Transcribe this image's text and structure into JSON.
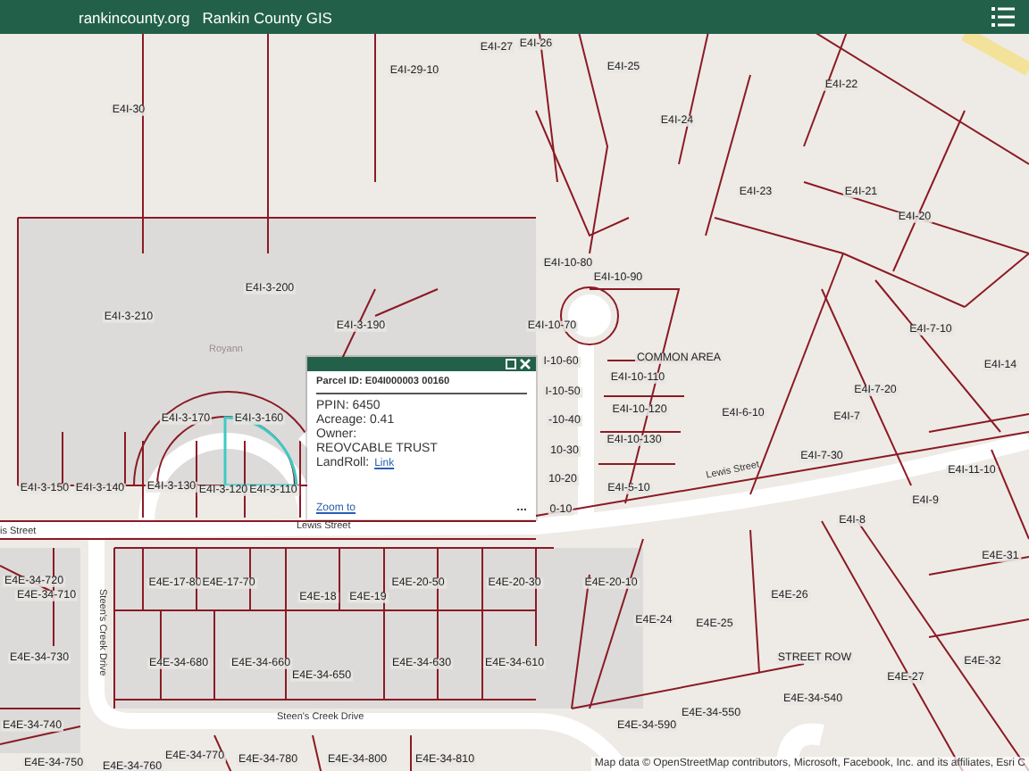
{
  "header": {
    "site_link": "rankincounty.org",
    "title": "Rankin County GIS"
  },
  "map": {
    "parcel_labels": [
      "E4I-27",
      "E4I-26",
      "E4I-29-10",
      "E4I-30",
      "E4I-25",
      "E4I-22",
      "E4I-24",
      "E4I-23",
      "E4I-21",
      "E4I-20",
      "E4I-3-200",
      "E4I-3-210",
      "E4I-3-190",
      "E4I-10-80",
      "E4I-10-90",
      "E4I-10-70",
      "I-10-60",
      "COMMON AREA",
      "I-10-50",
      "-10-40",
      "10-30",
      "10-20",
      "0-10",
      "E4I-10-110",
      "E4I-10-120",
      "E4I-10-130",
      "E4I-6-10",
      "E4I-5-10",
      "E4I-7-10",
      "E4I-14",
      "E4I-7-20",
      "E4I-7",
      "E4I-7-30",
      "E4I-11-10",
      "E4I-9",
      "E4I-8",
      "E4I-3-170",
      "E4I-3-160",
      "E4I-3-150",
      "E4I-3-140",
      "E4I-3-130",
      "E4I-3-120",
      "E4I-3-110",
      "E4E-34-720",
      "E4E-34-710",
      "E4E-17-80",
      "E4E-17-70",
      "E4E-18",
      "E4E-19",
      "E4E-20-50",
      "E4E-20-30",
      "E4E-20-10",
      "E4E-24",
      "E4E-25",
      "E4E-26",
      "STREET ROW",
      "E4E-27",
      "E4E-32",
      "E4E-31",
      "E4E-34-730",
      "E4E-34-680",
      "E4E-34-660",
      "E4E-34-650",
      "E4E-34-630",
      "E4E-34-610",
      "E4E-34-740",
      "E4E-34-590",
      "E4E-34-550",
      "E4E-34-540",
      "E4E-34-750",
      "E4E-34-760",
      "E4E-34-770",
      "E4E-34-780",
      "E4E-34-800",
      "E4E-34-810"
    ],
    "street_labels": [
      "Royann",
      "Lewis Street",
      "is Street",
      "Lewis Street",
      "Steen's Creek Drive",
      "Steen's Creek Drive"
    ],
    "attribution": "Map data © OpenStreetMap contributors, Microsoft, Facebook, Inc. and its affiliates, Esri C"
  },
  "popup": {
    "title": "Parcel ID: E04I000003 00160",
    "fields": [
      {
        "kind": "text",
        "text": "PPIN: 6450"
      },
      {
        "kind": "text",
        "text": "Acreage: 0.41"
      },
      {
        "kind": "text",
        "text": "Owner:"
      },
      {
        "kind": "text",
        "text": "REOVCABLE TRUST"
      },
      {
        "kind": "link",
        "label": "LandRoll:",
        "link": "Link"
      }
    ],
    "zoom_link": "Zoom to",
    "more": "..."
  }
}
